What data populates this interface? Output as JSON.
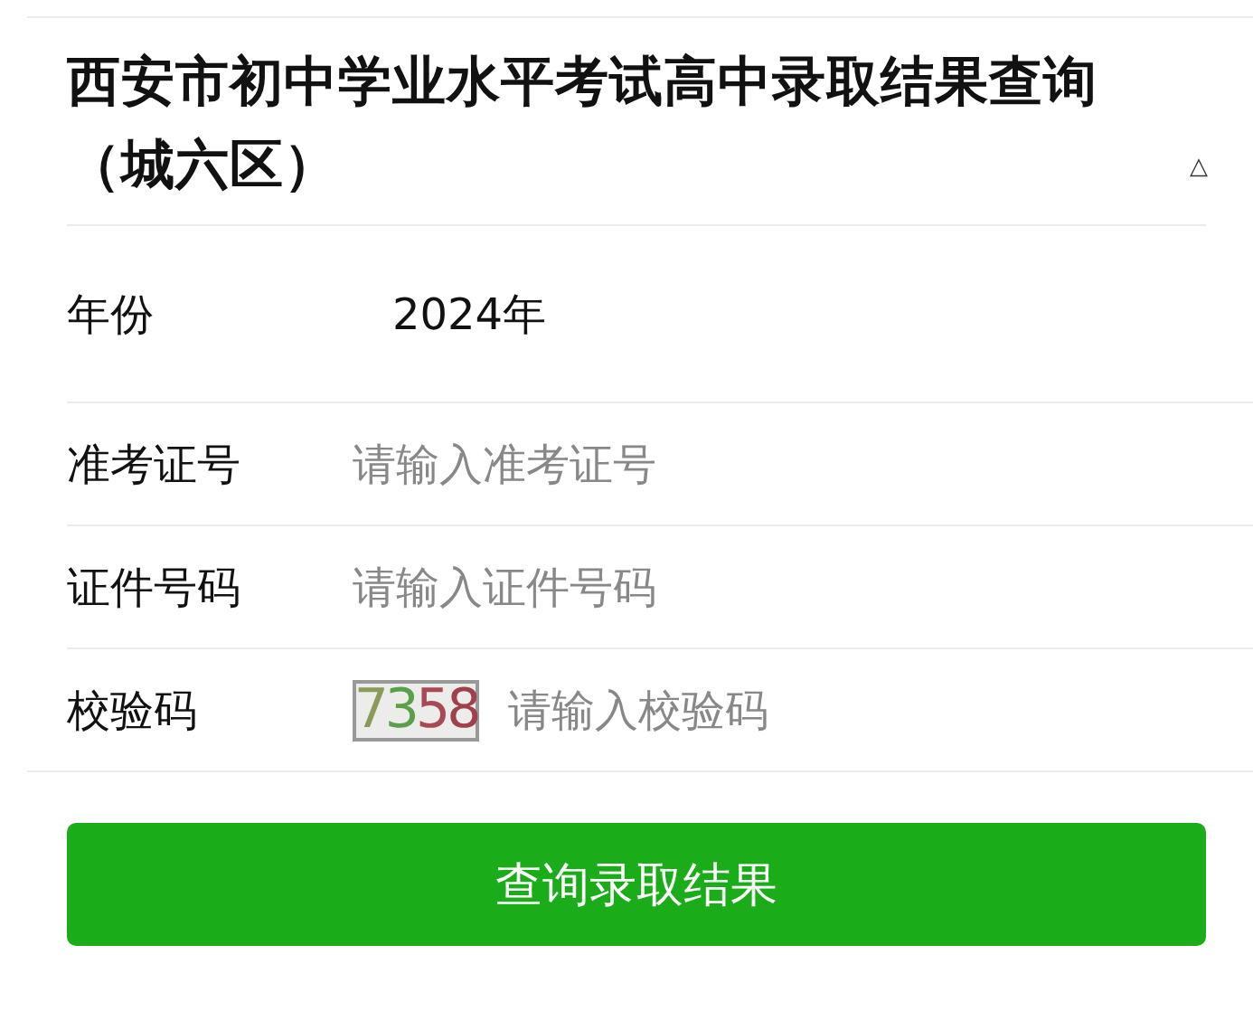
{
  "title": "西安市初中学业水平考试高中录取结果查询（城六区）",
  "toggle": "△",
  "fields": [
    {
      "kind": "value",
      "label": "年份",
      "value": "2024年"
    },
    {
      "kind": "input",
      "label": "准考证号",
      "placeholder": "请输入准考证号"
    },
    {
      "kind": "input",
      "label": "证件号码",
      "placeholder": "请输入证件号码"
    },
    {
      "kind": "captcha",
      "label": "校验码",
      "captcha": [
        {
          "text": "7",
          "color": "#8a9a5b"
        },
        {
          "text": "3",
          "color": "#5aa048"
        },
        {
          "text": "5",
          "color": "#a84a55"
        },
        {
          "text": "8",
          "color": "#a0404a"
        }
      ],
      "placeholder": "请输入校验码"
    }
  ],
  "button": "查询录取结果"
}
